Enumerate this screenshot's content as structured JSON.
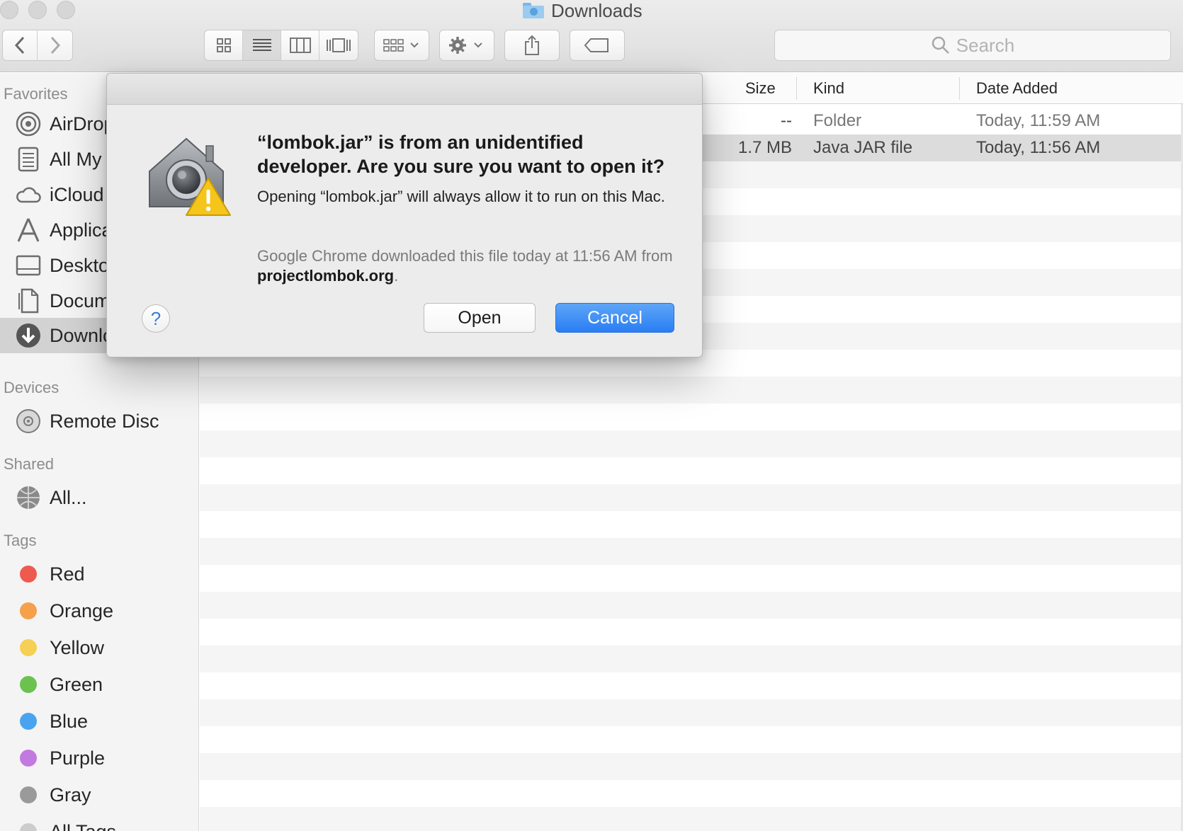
{
  "window": {
    "title": "Downloads",
    "search_placeholder": "Search"
  },
  "sidebar": {
    "favorites_header": "Favorites",
    "favorites": [
      {
        "label": "AirDrop",
        "icon": "airdrop-icon"
      },
      {
        "label": "All My Files",
        "icon": "all-my-files-icon"
      },
      {
        "label": "iCloud Drive",
        "icon": "icloud-icon"
      },
      {
        "label": "Applications",
        "icon": "applications-icon"
      },
      {
        "label": "Desktop",
        "icon": "desktop-icon"
      },
      {
        "label": "Documents",
        "icon": "documents-icon"
      },
      {
        "label": "Downloads",
        "icon": "downloads-icon"
      }
    ],
    "devices_header": "Devices",
    "devices": [
      {
        "label": "Remote Disc",
        "icon": "disc-icon"
      }
    ],
    "shared_header": "Shared",
    "shared": [
      {
        "label": "All...",
        "icon": "network-icon"
      }
    ],
    "tags_header": "Tags",
    "tags": [
      {
        "label": "Red",
        "color": "#ef5a4f"
      },
      {
        "label": "Orange",
        "color": "#f5a04a"
      },
      {
        "label": "Yellow",
        "color": "#f6cf55"
      },
      {
        "label": "Green",
        "color": "#6cc24f"
      },
      {
        "label": "Blue",
        "color": "#4aa3ef"
      },
      {
        "label": "Purple",
        "color": "#c27ae0"
      },
      {
        "label": "Gray",
        "color": "#9a9a9a"
      },
      {
        "label": "All Tags...",
        "color": "#cccccc"
      }
    ]
  },
  "list": {
    "columns": {
      "size": "Size",
      "kind": "Kind",
      "date_added": "Date Added"
    },
    "rows": [
      {
        "size": "--",
        "kind": "Folder",
        "date_added": "Today, 11:59 AM"
      },
      {
        "size": "1.7 MB",
        "kind": "Java JAR file",
        "date_added": "Today, 11:56 AM"
      }
    ]
  },
  "dialog": {
    "title": "“lombok.jar” is from an unidentified developer. Are you sure you want to open it?",
    "body": "Opening “lombok.jar” will always allow it to run on this Mac.",
    "note_prefix": "Google Chrome downloaded this file today at 11:56 AM from ",
    "note_source": "projectlombok.org",
    "note_suffix": ".",
    "help_label": "?",
    "open_label": "Open",
    "cancel_label": "Cancel"
  }
}
